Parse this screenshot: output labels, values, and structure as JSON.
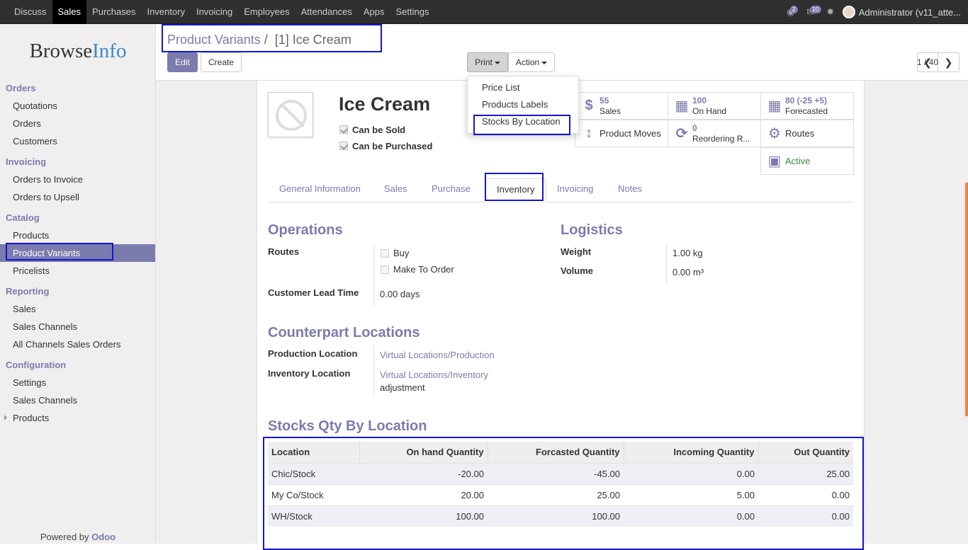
{
  "topnav": {
    "items": [
      "Discuss",
      "Sales",
      "Purchases",
      "Inventory",
      "Invoicing",
      "Employees",
      "Attendances",
      "Apps",
      "Settings"
    ],
    "active": "Sales",
    "chat_badge": "2",
    "activity_badge": "10",
    "user": "Administrator (v11_atte..."
  },
  "sidebar": {
    "logo_browse": "Browse",
    "logo_info": "Info",
    "sections": [
      {
        "title": "Orders",
        "items": [
          "Quotations",
          "Orders",
          "Customers"
        ]
      },
      {
        "title": "Invoicing",
        "items": [
          "Orders to Invoice",
          "Orders to Upsell"
        ]
      },
      {
        "title": "Catalog",
        "items": [
          "Products",
          "Product Variants",
          "Pricelists"
        ]
      },
      {
        "title": "Reporting",
        "items": [
          "Sales",
          "Sales Channels",
          "All Channels Sales Orders"
        ]
      },
      {
        "title": "Configuration",
        "items": [
          "Settings",
          "Sales Channels",
          "Products"
        ]
      }
    ],
    "active_item": "Product Variants",
    "powered_by": "Powered by",
    "powered_brand": "Odoo"
  },
  "control_panel": {
    "breadcrumb_parent": "Product Variants",
    "breadcrumb_sep": "/",
    "breadcrumb_current": "[1] Ice Cream",
    "edit_label": "Edit",
    "create_label": "Create",
    "print_label": "Print",
    "action_label": "Action",
    "pager": "1 / 40",
    "print_menu": [
      "Price List",
      "Products Labels",
      "Stocks By Location"
    ]
  },
  "product": {
    "name": "Ice Cream",
    "can_be_sold": "Can be Sold",
    "can_be_purchased": "Can be Purchased"
  },
  "smart_buttons": {
    "sales_value": "55",
    "sales_label": "Sales",
    "onhand_value": "100",
    "onhand_label": "On Hand",
    "forecast_value": "80 (-25 +5)",
    "forecast_label": "Forecasted",
    "moves_label": "Product Moves",
    "reorder_value": "0",
    "reorder_label": "Reordering R...",
    "routes_label": "Routes",
    "active_label": "Active"
  },
  "tabs": [
    "General Information",
    "Sales",
    "Purchase",
    "Inventory",
    "Invoicing",
    "Notes"
  ],
  "active_tab": "Inventory",
  "operations": {
    "title": "Operations",
    "routes_label": "Routes",
    "route_buy": "Buy",
    "route_mto": "Make To Order",
    "lead_time_label": "Customer Lead Time",
    "lead_time_value": "0.00 days"
  },
  "logistics": {
    "title": "Logistics",
    "weight_label": "Weight",
    "weight_value": "1.00 kg",
    "volume_label": "Volume",
    "volume_value": "0.00 m³"
  },
  "counterpart": {
    "title": "Counterpart Locations",
    "production_label": "Production Location",
    "production_value": "Virtual Locations/Production",
    "inventory_label": "Inventory Location",
    "inventory_value": "Virtual Locations/Inventory",
    "inventory_value2": "adjustment"
  },
  "stock_table": {
    "title": "Stocks Qty By Location",
    "headers": [
      "Location",
      "On hand Quantity",
      "Forcasted Quantity",
      "Incoming Quantity",
      "Out Quantity"
    ],
    "rows": [
      [
        "Chic/Stock",
        "-20.00",
        "-45.00",
        "0.00",
        "25.00"
      ],
      [
        "My Co/Stock",
        "20.00",
        "25.00",
        "5.00",
        "0.00"
      ],
      [
        "WH/Stock",
        "100.00",
        "100.00",
        "0.00",
        "0.00"
      ]
    ]
  },
  "colors": {
    "accent": "#7c7bad",
    "topbar": "#2f2f2f",
    "highlight": "#1616d2"
  }
}
